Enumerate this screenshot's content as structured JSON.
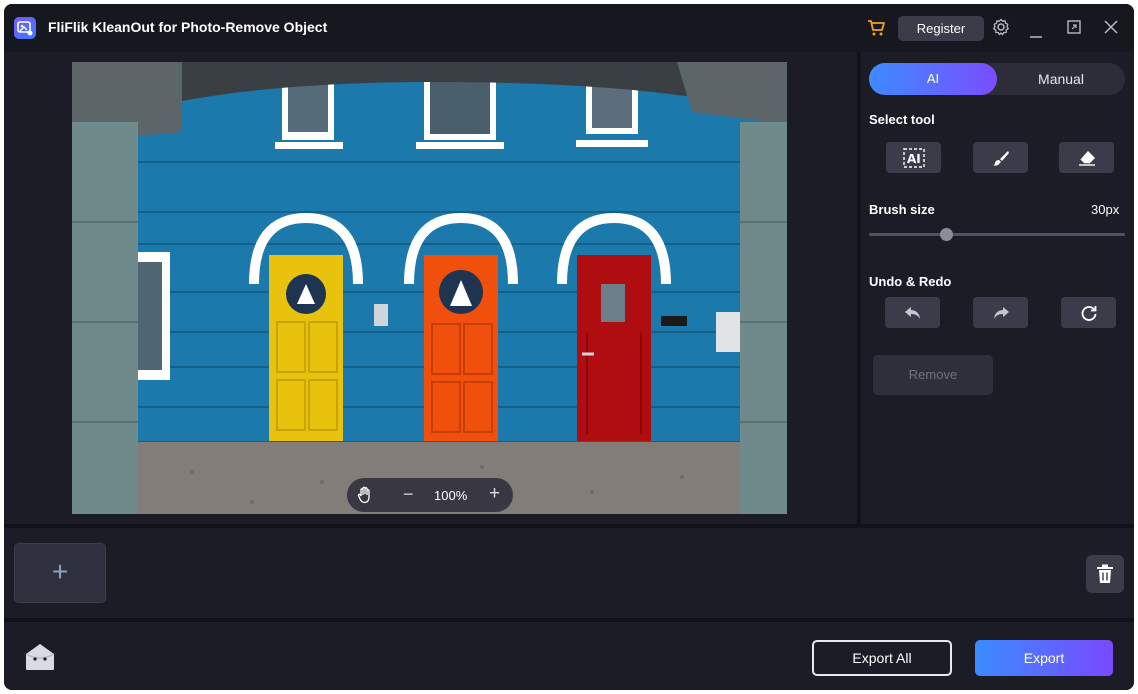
{
  "app": {
    "title": "FliFlik KleanOut for Photo-Remove Object",
    "register_label": "Register",
    "icons": [
      "app-logo-icon",
      "cart-icon",
      "settings-icon",
      "minimize-icon",
      "restore-icon",
      "close-icon"
    ]
  },
  "canvas": {
    "zoom_level": "100%",
    "icons": [
      "hand-icon",
      "zoom-out-icon",
      "zoom-in-icon"
    ]
  },
  "panel": {
    "modes": [
      "AI",
      "Manual"
    ],
    "active_mode": "AI",
    "select_tool_label": "Select tool",
    "tools": [
      "ai-select-icon",
      "brush-icon",
      "eraser-icon"
    ],
    "brush_size_label": "Brush size",
    "brush_size_value": "30px",
    "undo_redo_label": "Undo & Redo",
    "remove_label": "Remove"
  },
  "strip": {
    "add_label": "+"
  },
  "footer": {
    "export_all_label": "Export All",
    "export_label": "Export"
  },
  "colors": {
    "accent_start": "#3a8cff",
    "accent_end": "#7a49ff",
    "background": "#1b1c26"
  }
}
